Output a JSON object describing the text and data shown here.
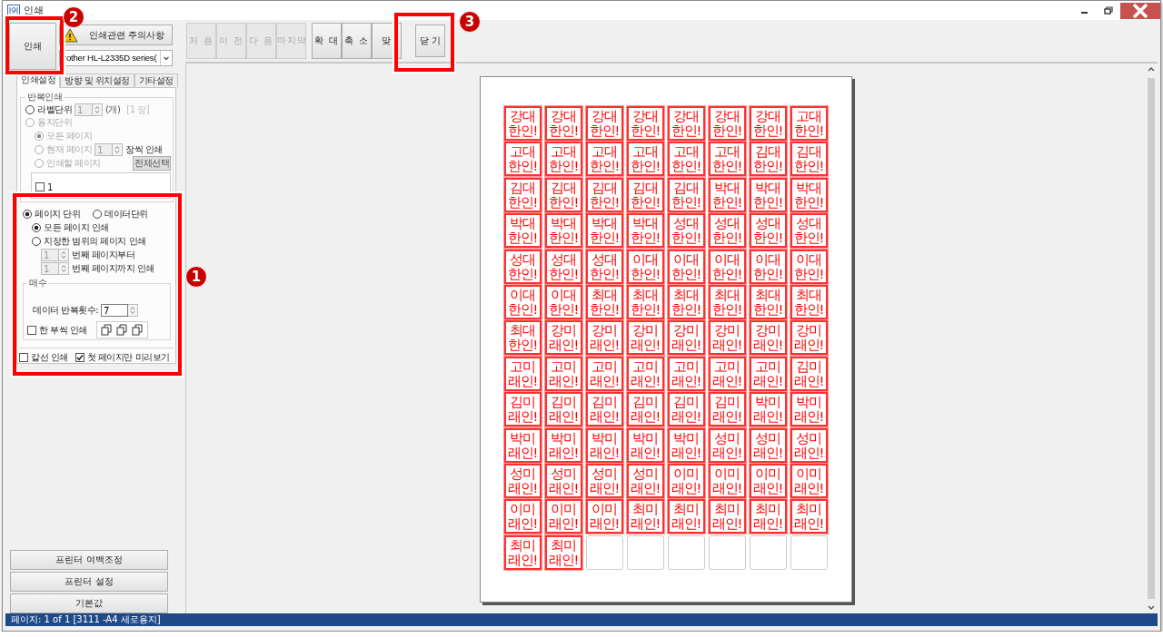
{
  "window": {
    "title": "인쇄"
  },
  "print_button": {
    "label": "인쇄"
  },
  "notice_button": {
    "label": "인쇄관련 주의사항"
  },
  "printer_select": {
    "value": "rother HL-L2335D series("
  },
  "tabs": [
    {
      "label": "인쇄설정",
      "selected": true
    },
    {
      "label": "방향 및 위치설정",
      "selected": false
    },
    {
      "label": "기타설정",
      "selected": false
    }
  ],
  "repeat_group": {
    "title": "반복인쇄",
    "label_unit": {
      "label": "라벨단위",
      "selected": false,
      "value": "1",
      "unit": "(개)",
      "sheets": "[1 장]"
    },
    "paper_unit": {
      "label": "용지단위",
      "selected": false,
      "disabled": true
    },
    "page_options": [
      {
        "label": "모든 페이지",
        "selected": true,
        "disabled": true
      },
      {
        "label": "현재 페이지",
        "selected": false,
        "disabled": true
      },
      {
        "label": "인쇄할 페이지",
        "selected": false,
        "disabled": true
      }
    ],
    "current_page_value": "1",
    "per_sheet_label": "장씩 인쇄",
    "select_all_button": "전체선택",
    "page_list": [
      {
        "label": "1",
        "checked": false
      }
    ]
  },
  "unit_options": [
    {
      "label": "페이지 단위",
      "selected": true
    },
    {
      "label": "데이터단위",
      "selected": false
    }
  ],
  "range_options": [
    {
      "label": "모든 페이지 인쇄",
      "selected": true
    },
    {
      "label": "지정한 범위의 페이지 인쇄",
      "selected": false
    }
  ],
  "range_from": {
    "value": "1",
    "label": "번째 페이지부터"
  },
  "range_to": {
    "value": "1",
    "label": "번째 페이지까지 인쇄"
  },
  "copies_group": {
    "title": "매수",
    "repeat_label": "데이터 반복횟수:",
    "repeat_value": "7",
    "collate": {
      "label": "한 부씩 인쇄",
      "checked": false
    }
  },
  "cut_line": {
    "label": "칼선 인쇄",
    "checked": false
  },
  "first_page_only": {
    "label": "첫 페이지만 미리보기",
    "checked": true
  },
  "bottom_buttons": [
    "프린터 여백조정",
    "프린터 설정",
    "기본값"
  ],
  "nav_buttons": [
    {
      "label": "처 음",
      "disabled": true
    },
    {
      "label": "이 전",
      "disabled": true
    },
    {
      "label": "다 음",
      "disabled": true
    },
    {
      "label": "마지막",
      "disabled": true
    }
  ],
  "zoom_buttons": [
    {
      "label": "확 대",
      "disabled": false
    },
    {
      "label": "축 소",
      "disabled": false
    },
    {
      "label": "맞",
      "disabled": false
    }
  ],
  "close_button": {
    "label": "닫 기"
  },
  "labels": [
    {
      "kind": "stamp",
      "top": "강대",
      "bottom": "한인!"
    },
    {
      "kind": "stamp",
      "top": "강대",
      "bottom": "한인!"
    },
    {
      "kind": "stamp",
      "top": "강대",
      "bottom": "한인!"
    },
    {
      "kind": "stamp",
      "top": "강대",
      "bottom": "한인!"
    },
    {
      "kind": "stamp",
      "top": "강대",
      "bottom": "한인!"
    },
    {
      "kind": "stamp",
      "top": "강대",
      "bottom": "한인!"
    },
    {
      "kind": "stamp",
      "top": "강대",
      "bottom": "한인!"
    },
    {
      "kind": "stamp",
      "top": "고대",
      "bottom": "한인!"
    },
    {
      "kind": "stamp",
      "top": "고대",
      "bottom": "한인!"
    },
    {
      "kind": "stamp",
      "top": "고대",
      "bottom": "한인!"
    },
    {
      "kind": "stamp",
      "top": "고대",
      "bottom": "한인!"
    },
    {
      "kind": "stamp",
      "top": "고대",
      "bottom": "한인!"
    },
    {
      "kind": "stamp",
      "top": "고대",
      "bottom": "한인!"
    },
    {
      "kind": "stamp",
      "top": "고대",
      "bottom": "한인!"
    },
    {
      "kind": "stamp",
      "top": "김대",
      "bottom": "한인!"
    },
    {
      "kind": "stamp",
      "top": "김대",
      "bottom": "한인!"
    },
    {
      "kind": "stamp",
      "top": "김대",
      "bottom": "한인!"
    },
    {
      "kind": "stamp",
      "top": "김대",
      "bottom": "한인!"
    },
    {
      "kind": "stamp",
      "top": "김대",
      "bottom": "한인!"
    },
    {
      "kind": "stamp",
      "top": "김대",
      "bottom": "한인!"
    },
    {
      "kind": "stamp",
      "top": "김대",
      "bottom": "한인!"
    },
    {
      "kind": "stamp",
      "top": "박대",
      "bottom": "한인!"
    },
    {
      "kind": "stamp",
      "top": "박대",
      "bottom": "한인!"
    },
    {
      "kind": "stamp",
      "top": "박대",
      "bottom": "한인!"
    },
    {
      "kind": "stamp",
      "top": "박대",
      "bottom": "한인!"
    },
    {
      "kind": "stamp",
      "top": "박대",
      "bottom": "한인!"
    },
    {
      "kind": "stamp",
      "top": "박대",
      "bottom": "한인!"
    },
    {
      "kind": "stamp",
      "top": "박대",
      "bottom": "한인!"
    },
    {
      "kind": "stamp",
      "top": "성대",
      "bottom": "한인!"
    },
    {
      "kind": "stamp",
      "top": "성대",
      "bottom": "한인!"
    },
    {
      "kind": "stamp",
      "top": "성대",
      "bottom": "한인!"
    },
    {
      "kind": "stamp",
      "top": "성대",
      "bottom": "한인!"
    },
    {
      "kind": "stamp",
      "top": "성대",
      "bottom": "한인!"
    },
    {
      "kind": "stamp",
      "top": "성대",
      "bottom": "한인!"
    },
    {
      "kind": "stamp",
      "top": "성대",
      "bottom": "한인!"
    },
    {
      "kind": "stamp",
      "top": "이대",
      "bottom": "한인!"
    },
    {
      "kind": "stamp",
      "top": "이대",
      "bottom": "한인!"
    },
    {
      "kind": "stamp",
      "top": "이대",
      "bottom": "한인!"
    },
    {
      "kind": "stamp",
      "top": "이대",
      "bottom": "한인!"
    },
    {
      "kind": "stamp",
      "top": "이대",
      "bottom": "한인!"
    },
    {
      "kind": "stamp",
      "top": "이대",
      "bottom": "한인!"
    },
    {
      "kind": "stamp",
      "top": "이대",
      "bottom": "한인!"
    },
    {
      "kind": "stamp",
      "top": "최대",
      "bottom": "한인!"
    },
    {
      "kind": "stamp",
      "top": "최대",
      "bottom": "한인!"
    },
    {
      "kind": "stamp",
      "top": "최대",
      "bottom": "한인!"
    },
    {
      "kind": "stamp",
      "top": "최대",
      "bottom": "한인!"
    },
    {
      "kind": "stamp",
      "top": "최대",
      "bottom": "한인!"
    },
    {
      "kind": "stamp",
      "top": "최대",
      "bottom": "한인!"
    },
    {
      "kind": "stamp",
      "top": "최대",
      "bottom": "한인!"
    },
    {
      "kind": "stamp",
      "top": "강미",
      "bottom": "래인!"
    },
    {
      "kind": "stamp",
      "top": "강미",
      "bottom": "래인!"
    },
    {
      "kind": "stamp",
      "top": "강미",
      "bottom": "래인!"
    },
    {
      "kind": "stamp",
      "top": "강미",
      "bottom": "래인!"
    },
    {
      "kind": "stamp",
      "top": "강미",
      "bottom": "래인!"
    },
    {
      "kind": "stamp",
      "top": "강미",
      "bottom": "래인!"
    },
    {
      "kind": "stamp",
      "top": "강미",
      "bottom": "래인!"
    },
    {
      "kind": "stamp",
      "top": "고미",
      "bottom": "래인!"
    },
    {
      "kind": "stamp",
      "top": "고미",
      "bottom": "래인!"
    },
    {
      "kind": "stamp",
      "top": "고미",
      "bottom": "래인!"
    },
    {
      "kind": "stamp",
      "top": "고미",
      "bottom": "래인!"
    },
    {
      "kind": "stamp",
      "top": "고미",
      "bottom": "래인!"
    },
    {
      "kind": "stamp",
      "top": "고미",
      "bottom": "래인!"
    },
    {
      "kind": "stamp",
      "top": "고미",
      "bottom": "래인!"
    },
    {
      "kind": "stamp",
      "top": "김미",
      "bottom": "래인!"
    },
    {
      "kind": "stamp",
      "top": "김미",
      "bottom": "래인!"
    },
    {
      "kind": "stamp",
      "top": "김미",
      "bottom": "래인!"
    },
    {
      "kind": "stamp",
      "top": "김미",
      "bottom": "래인!"
    },
    {
      "kind": "stamp",
      "top": "김미",
      "bottom": "래인!"
    },
    {
      "kind": "stamp",
      "top": "김미",
      "bottom": "래인!"
    },
    {
      "kind": "stamp",
      "top": "김미",
      "bottom": "래인!"
    },
    {
      "kind": "stamp",
      "top": "박미",
      "bottom": "래인!"
    },
    {
      "kind": "stamp",
      "top": "박미",
      "bottom": "래인!"
    },
    {
      "kind": "stamp",
      "top": "박미",
      "bottom": "래인!"
    },
    {
      "kind": "stamp",
      "top": "박미",
      "bottom": "래인!"
    },
    {
      "kind": "stamp",
      "top": "박미",
      "bottom": "래인!"
    },
    {
      "kind": "stamp",
      "top": "박미",
      "bottom": "래인!"
    },
    {
      "kind": "stamp",
      "top": "박미",
      "bottom": "래인!"
    },
    {
      "kind": "stamp",
      "top": "성미",
      "bottom": "래인!"
    },
    {
      "kind": "stamp",
      "top": "성미",
      "bottom": "래인!"
    },
    {
      "kind": "stamp",
      "top": "성미",
      "bottom": "래인!"
    },
    {
      "kind": "stamp",
      "top": "성미",
      "bottom": "래인!"
    },
    {
      "kind": "stamp",
      "top": "성미",
      "bottom": "래인!"
    },
    {
      "kind": "stamp",
      "top": "성미",
      "bottom": "래인!"
    },
    {
      "kind": "stamp",
      "top": "성미",
      "bottom": "래인!"
    },
    {
      "kind": "stamp",
      "top": "이미",
      "bottom": "래인!"
    },
    {
      "kind": "stamp",
      "top": "이미",
      "bottom": "래인!"
    },
    {
      "kind": "stamp",
      "top": "이미",
      "bottom": "래인!"
    },
    {
      "kind": "stamp",
      "top": "이미",
      "bottom": "래인!"
    },
    {
      "kind": "stamp",
      "top": "이미",
      "bottom": "래인!"
    },
    {
      "kind": "stamp",
      "top": "이미",
      "bottom": "래인!"
    },
    {
      "kind": "stamp",
      "top": "이미",
      "bottom": "래인!"
    },
    {
      "kind": "stamp",
      "top": "최미",
      "bottom": "래인!"
    },
    {
      "kind": "stamp",
      "top": "최미",
      "bottom": "래인!"
    },
    {
      "kind": "stamp",
      "top": "최미",
      "bottom": "래인!"
    },
    {
      "kind": "stamp",
      "top": "최미",
      "bottom": "래인!"
    },
    {
      "kind": "stamp",
      "top": "최미",
      "bottom": "래인!"
    },
    {
      "kind": "stamp",
      "top": "최미",
      "bottom": "래인!"
    },
    {
      "kind": "stamp",
      "top": "최미",
      "bottom": "래인!"
    },
    {
      "kind": "blank"
    },
    {
      "kind": "blank"
    },
    {
      "kind": "blank"
    },
    {
      "kind": "blank"
    },
    {
      "kind": "blank"
    },
    {
      "kind": "blank"
    }
  ],
  "annotations": [
    {
      "number": "1"
    },
    {
      "number": "2"
    },
    {
      "number": "3"
    }
  ],
  "status_bar": "페이지: 1 of 1 [3111 -A4 세로용지]"
}
